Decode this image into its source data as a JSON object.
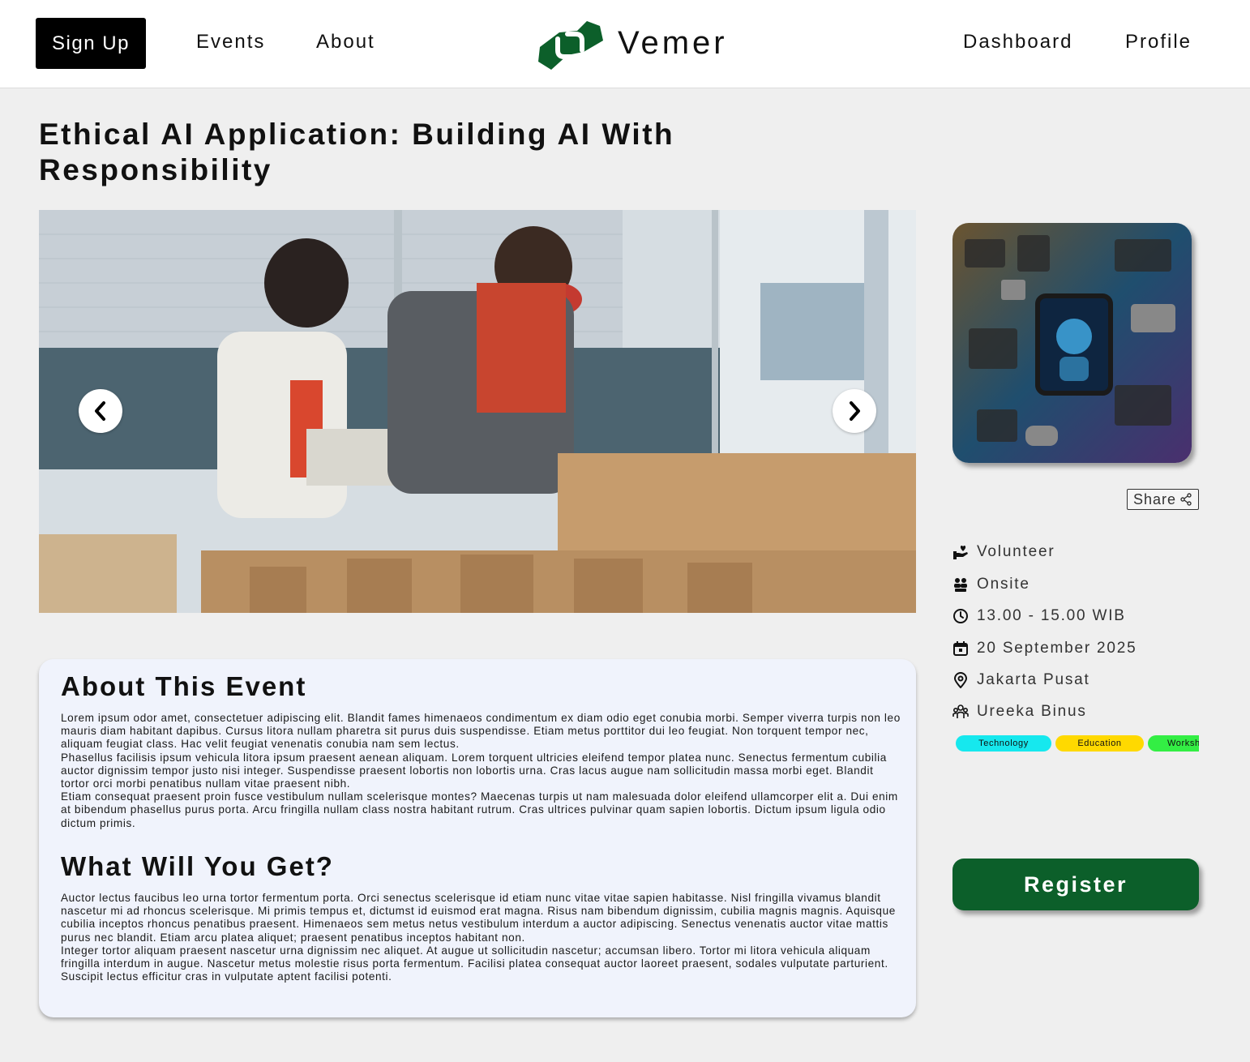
{
  "nav": {
    "signup": "Sign Up",
    "events": "Events",
    "about": "About",
    "brand": "Vemer",
    "dashboard": "Dashboard",
    "profile": "Profile"
  },
  "event": {
    "title": "Ethical AI Application: Building AI With Responsibility"
  },
  "about": {
    "heading": "About This Event",
    "body": "Lorem ipsum odor amet, consectetuer adipiscing elit. Blandit fames himenaeos condimentum ex diam odio eget conubia morbi. Semper viverra turpis non leo mauris diam habitant dapibus. Cursus litora nullam pharetra sit purus duis suspendisse. Etiam metus porttitor dui leo feugiat. Non torquent tempor nec, aliquam feugiat class. Hac velit feugiat venenatis conubia nam sem lectus.\nPhasellus facilisis ipsum vehicula litora ipsum praesent aenean aliquam. Lorem torquent ultricies eleifend tempor platea nunc. Senectus fermentum cubilia auctor dignissim tempor justo nisi integer. Suspendisse praesent lobortis non lobortis urna. Cras lacus augue nam sollicitudin massa morbi eget. Blandit tortor orci morbi penatibus nullam vitae praesent nibh.\nEtiam consequat praesent proin fusce vestibulum nullam scelerisque montes? Maecenas turpis ut nam malesuada dolor eleifend ullamcorper elit a. Dui enim at bibendum phasellus purus porta. Arcu fringilla nullam class nostra habitant rutrum. Cras ultrices pulvinar quam sapien lobortis. Dictum ipsum ligula odio dictum primis."
  },
  "get": {
    "heading": "What Will You Get?",
    "body": "Auctor lectus faucibus leo urna tortor fermentum porta. Orci senectus scelerisque id etiam nunc vitae vitae sapien habitasse. Nisl fringilla vivamus blandit nascetur mi ad rhoncus scelerisque. Mi primis tempus et, dictumst id euismod erat magna. Risus nam bibendum dignissim, cubilia magnis magnis. Aquisque cubilia inceptos rhoncus penatibus praesent. Himenaeos sem metus netus vestibulum interdum a auctor adipiscing. Senectus venenatis auctor vitae mattis purus nec blandit. Etiam arcu platea aliquet; praesent penatibus inceptos habitant non.\nInteger tortor aliquam praesent nascetur urna dignissim nec aliquet. At augue ut sollicitudin nascetur; accumsan libero. Tortor mi litora vehicula aliquam fringilla interdum in augue. Nascetur metus molestie risus porta fermentum. Facilisi platea consequat auctor laoreet praesent, sodales vulputate parturient. Suscipit lectus efficitur cras in vulputate aptent facilisi potenti."
  },
  "sidebar": {
    "share": "Share",
    "details": {
      "type": "Volunteer",
      "mode": "Onsite",
      "time": "13.00 - 15.00 WIB",
      "date": "20 September 2025",
      "location": "Jakarta Pusat",
      "organizer": "Ureeka Binus"
    },
    "tags": {
      "t1": "Technology",
      "t2": "Education",
      "t3": "Workshop"
    },
    "register": "Register"
  },
  "colors": {
    "brand_green": "#0c5f2a",
    "tag_technology": "#16e8ee",
    "tag_education": "#ffd900",
    "tag_workshop": "#33ee44"
  },
  "icons": {
    "carousel_prev": "chevron-left-icon",
    "carousel_next": "chevron-right-icon",
    "share": "share-icon",
    "type": "volunteer-hand-heart-icon",
    "mode": "people-group-icon",
    "time": "clock-icon",
    "date": "calendar-icon",
    "location": "map-pin-icon",
    "organizer": "organization-users-icon"
  }
}
